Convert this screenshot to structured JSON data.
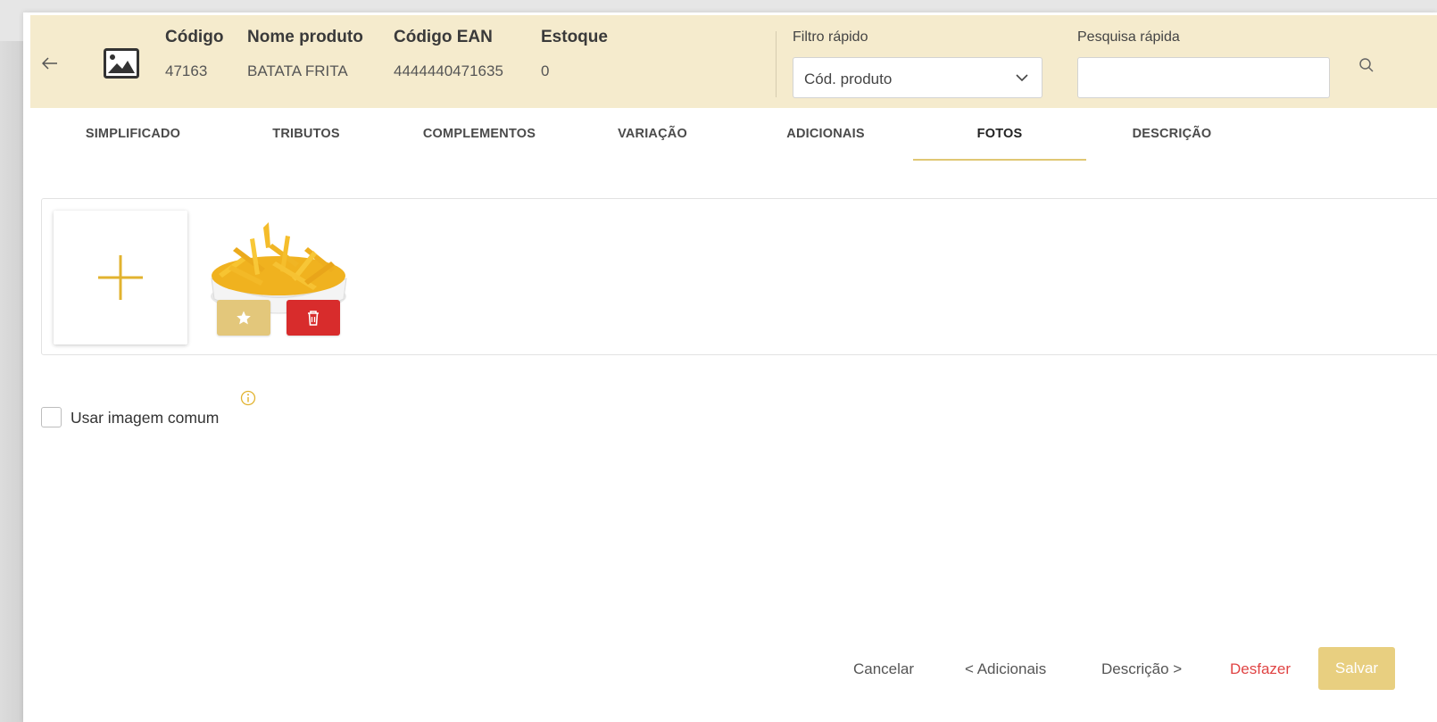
{
  "header": {
    "columns": [
      {
        "label": "Código",
        "value": "47163"
      },
      {
        "label": "Nome produto",
        "value": "BATATA FRITA"
      },
      {
        "label": "Código EAN",
        "value": "4444440471635"
      },
      {
        "label": "Estoque",
        "value": "0"
      }
    ],
    "filter": {
      "label": "Filtro rápido",
      "selected": "Cód. produto"
    },
    "search": {
      "label": "Pesquisa rápida",
      "value": "",
      "placeholder": ""
    }
  },
  "tabs": [
    {
      "label": "SIMPLIFICADO"
    },
    {
      "label": "TRIBUTOS"
    },
    {
      "label": "COMPLEMENTOS"
    },
    {
      "label": "VARIAÇÃO"
    },
    {
      "label": "ADICIONAIS"
    },
    {
      "label": "FOTOS",
      "active": true
    },
    {
      "label": "DESCRIÇÃO"
    }
  ],
  "photos": {
    "add_icon": "plus-icon",
    "items": [
      {
        "favorite_icon": "star-icon",
        "delete_icon": "trash-icon"
      }
    ]
  },
  "common_image": {
    "label": "Usar imagem comum",
    "checked": false,
    "info_icon": "info-icon"
  },
  "footer": {
    "cancel": "Cancelar",
    "prev": "< Adicionais",
    "next": "Descrição >",
    "undo": "Desfazer",
    "save": "Salvar"
  },
  "colors": {
    "header_bg": "#f5ebcd",
    "accent": "#e3c77b",
    "danger": "#d82c2c",
    "undo_text": "#e04444"
  }
}
